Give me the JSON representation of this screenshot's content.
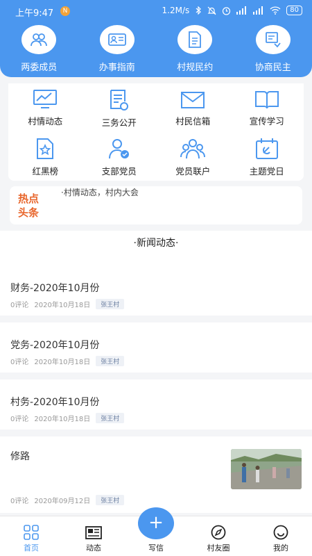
{
  "status_bar": {
    "time": "上午9:47",
    "badge": "N",
    "speed": "1.2M/s",
    "battery": "80"
  },
  "top_nav": [
    {
      "label": "两委成员",
      "icon": "people-icon"
    },
    {
      "label": "办事指南",
      "icon": "id-card-icon"
    },
    {
      "label": "村规民约",
      "icon": "document-icon"
    },
    {
      "label": "协商民主",
      "icon": "discussion-icon"
    }
  ],
  "grid": [
    {
      "label": "村情动态",
      "icon": "trend-monitor-icon"
    },
    {
      "label": "三务公开",
      "icon": "notice-icon"
    },
    {
      "label": "村民信箱",
      "icon": "mail-icon"
    },
    {
      "label": "宣传学习",
      "icon": "book-icon"
    },
    {
      "label": "红黑榜",
      "icon": "star-file-icon"
    },
    {
      "label": "支部党员",
      "icon": "member-icon"
    },
    {
      "label": "党员联户",
      "icon": "group-icon"
    },
    {
      "label": "主题党日",
      "icon": "calendar-icon"
    }
  ],
  "hot": {
    "tag": "热点头条",
    "text": "·村情动态，村内大会"
  },
  "news": {
    "title": "·新闻动态·",
    "items": [
      {
        "title": "财务-2020年10月份",
        "comments": "0评论",
        "date": "2020年10月18日",
        "tag": "张王村"
      },
      {
        "title": "党务-2020年10月份",
        "comments": "0评论",
        "date": "2020年10月18日",
        "tag": "张王村"
      },
      {
        "title": "村务-2020年10月份",
        "comments": "0评论",
        "date": "2020年10月18日",
        "tag": "张王村"
      },
      {
        "title": "修路",
        "comments": "0评论",
        "date": "2020年09月12日",
        "tag": "张王村"
      }
    ]
  },
  "tabs": [
    {
      "label": "首页",
      "icon": "home-grid-icon",
      "active": true
    },
    {
      "label": "动态",
      "icon": "newspaper-icon"
    },
    {
      "label": "写信",
      "icon": "plus-icon"
    },
    {
      "label": "村友圈",
      "icon": "compass-icon"
    },
    {
      "label": "我的",
      "icon": "smile-icon"
    }
  ],
  "fab": {
    "symbol": "+"
  },
  "colors": {
    "primary": "#4b97ef",
    "hot": "#e8662c"
  }
}
